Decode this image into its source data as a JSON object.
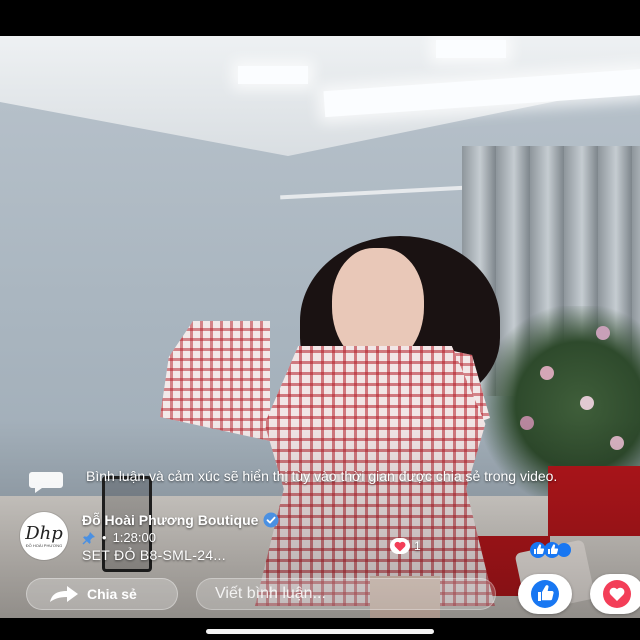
{
  "notice": {
    "text": "Bình luận và cảm xúc sẽ hiển thị tùy vào thời gian được chia sẻ trong video."
  },
  "page": {
    "name": "Đỗ Hoài Phương Boutique",
    "avatar_mono": "Dhp",
    "avatar_sub": "ĐỖ HOÀI PHƯƠNG",
    "timestamp": "1:28:00",
    "product": "SET ĐỎ B8-SML-24..."
  },
  "reactions": {
    "heart_count": "1"
  },
  "bottom_bar": {
    "share_label": "Chia sẻ",
    "comment_placeholder": "Viết bình luận..."
  },
  "colors": {
    "facebook_blue": "#1877F2",
    "love_red": "#F33E58",
    "verified_blue": "#4A90E2"
  },
  "icons": [
    "comment-bubble-icon",
    "verified-badge-icon",
    "pin-icon",
    "heart-icon",
    "like-icon",
    "share-arrow-icon"
  ]
}
